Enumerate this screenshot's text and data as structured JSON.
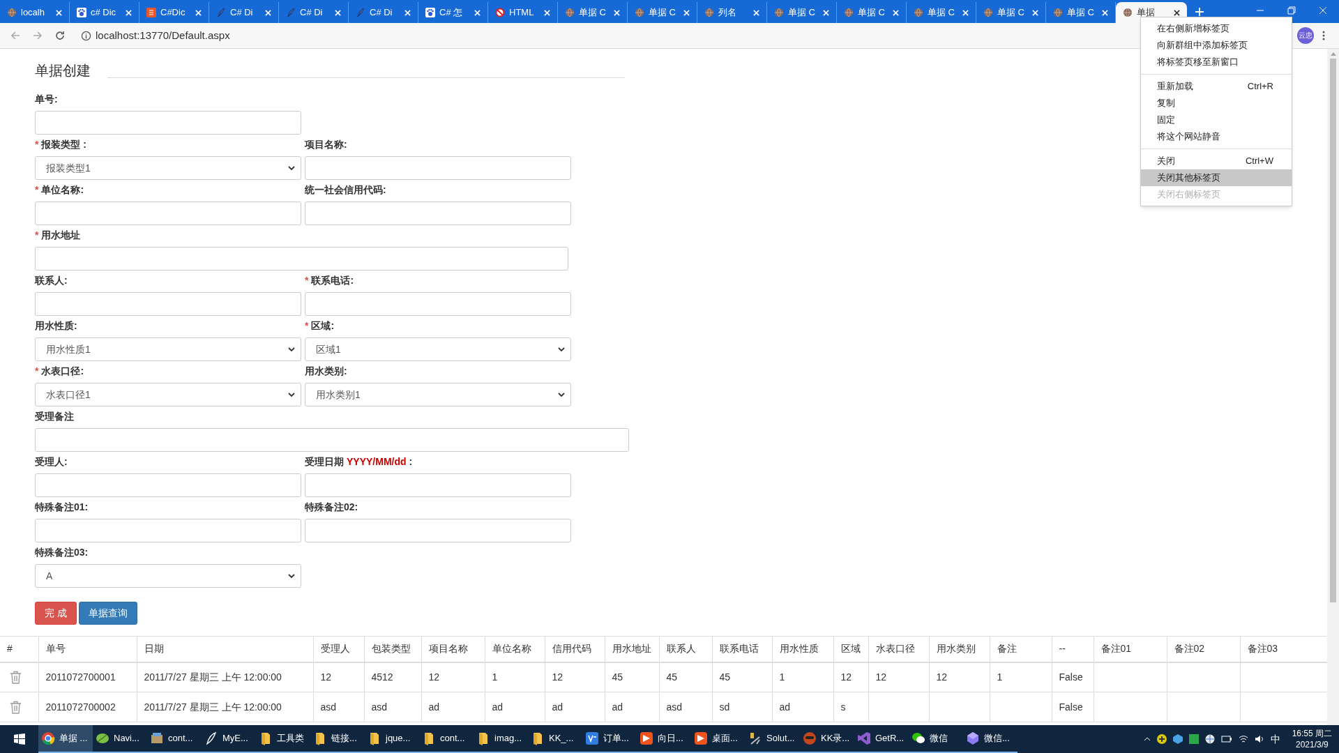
{
  "browser": {
    "tabs": [
      {
        "title": "localh",
        "kind": "globe",
        "selected": false
      },
      {
        "title": "c# Dic",
        "kind": "paw",
        "selected": false
      },
      {
        "title": "C#Dic",
        "kind": "red",
        "selected": false
      },
      {
        "title": "C# Di",
        "kind": "feather",
        "selected": false
      },
      {
        "title": "C# Di",
        "kind": "feather",
        "selected": false
      },
      {
        "title": "C# Di",
        "kind": "feather",
        "selected": false
      },
      {
        "title": "C# 怎",
        "kind": "paw",
        "selected": false
      },
      {
        "title": "HTML",
        "kind": "ban",
        "selected": false
      },
      {
        "title": "单据 C",
        "kind": "globe",
        "selected": false
      },
      {
        "title": "单据 C",
        "kind": "globe",
        "selected": false
      },
      {
        "title": "列名",
        "kind": "globe",
        "selected": false
      },
      {
        "title": "单据 C",
        "kind": "globe",
        "selected": false
      },
      {
        "title": "单据 C",
        "kind": "globe",
        "selected": false
      },
      {
        "title": "单据 C",
        "kind": "globe",
        "selected": false
      },
      {
        "title": "单据 C",
        "kind": "globe",
        "selected": false
      },
      {
        "title": "单据 C",
        "kind": "globe",
        "selected": false
      },
      {
        "title": "单据",
        "kind": "globe",
        "selected": true
      }
    ],
    "address": "localhost:13770/Default.aspx",
    "profile": "云忠"
  },
  "context_menu": {
    "groups": [
      [
        {
          "label": "在右侧新增标签页",
          "selected": false,
          "disabled": false
        },
        {
          "label": "向新群组中添加标签页",
          "selected": false,
          "disabled": false
        },
        {
          "label": "将标签页移至新窗口",
          "selected": false,
          "disabled": false
        }
      ],
      [
        {
          "label": "重新加载",
          "shortcut": "Ctrl+R",
          "selected": false,
          "disabled": false
        },
        {
          "label": "复制",
          "selected": false,
          "disabled": false
        },
        {
          "label": "固定",
          "selected": false,
          "disabled": false
        },
        {
          "label": "将这个网站静音",
          "selected": false,
          "disabled": false
        }
      ],
      [
        {
          "label": "关闭",
          "shortcut": "Ctrl+W",
          "selected": false,
          "disabled": false
        },
        {
          "label": "关闭其他标签页",
          "selected": true,
          "disabled": false
        },
        {
          "label": "关闭右侧标签页",
          "selected": false,
          "disabled": true
        }
      ]
    ]
  },
  "page": {
    "title": "单据创建",
    "rows": [
      [
        {
          "label": "单号:",
          "kind": "input"
        }
      ],
      [
        {
          "mark": "*",
          "label": "报装类型 :",
          "kind": "select",
          "value": "报装类型1"
        },
        {
          "label": "项目名称:",
          "kind": "input"
        }
      ],
      [
        {
          "mark": "*",
          "label": "单位名称:",
          "kind": "input"
        },
        {
          "label": "统一社会信用代码:",
          "kind": "input"
        }
      ],
      [
        {
          "mark": "*",
          "label": "用水地址",
          "kind": "wide"
        }
      ],
      [
        {
          "label": "联系人:",
          "kind": "input"
        },
        {
          "mark": "*",
          "label": "联系电话:",
          "kind": "input"
        }
      ],
      [
        {
          "label": "用水性质:",
          "kind": "select",
          "value": "用水性质1"
        },
        {
          "mark": "*",
          "label": "区域:",
          "kind": "select",
          "value": "区域1"
        }
      ],
      [
        {
          "mark": "*",
          "label": "水表口径:",
          "kind": "select",
          "value": "水表口径1"
        },
        {
          "label": "用水类别:",
          "kind": "select",
          "value": "用水类别1"
        }
      ],
      [
        {
          "label": "受理备注",
          "kind": "full"
        }
      ],
      [
        {
          "label": "受理人:",
          "kind": "input"
        },
        {
          "label": "受理日期",
          "format": "YYYY/MM/dd",
          "label_end": ":",
          "kind": "input"
        }
      ],
      [
        {
          "label": "特殊备注01:",
          "kind": "input"
        },
        {
          "label": "特殊备注02:",
          "kind": "input"
        }
      ],
      [
        {
          "label": "特殊备注03:",
          "kind": "select",
          "value": "A"
        }
      ]
    ],
    "buttons": [
      {
        "label": "完 成",
        "kind": "danger"
      },
      {
        "label": "单据查询",
        "kind": "primary"
      }
    ],
    "table": {
      "columns": [
        "#",
        "单号",
        "日期",
        "受理人",
        "包装类型",
        "项目名称",
        "单位名称",
        "信用代码",
        "用水地址",
        "联系人",
        "联系电话",
        "用水性质",
        "区域",
        "水表口径",
        "用水类别",
        "备注",
        "--",
        "备注01",
        "备注02",
        "备注03"
      ],
      "rows": [
        [
          "",
          "2011072700001",
          "2011/7/27 星期三 上午 12:00:00",
          "12",
          "4512",
          "12",
          "1",
          "12",
          "45",
          "45",
          "45",
          "1",
          "12",
          "12",
          "12",
          "1",
          "False",
          "",
          "",
          ""
        ],
        [
          "",
          "2011072700002",
          "2011/7/27 星期三 上午 12:00:00",
          "asd",
          "asd",
          "ad",
          "ad",
          "ad",
          "ad",
          "asd",
          "sd",
          "ad",
          "s",
          "",
          "",
          "",
          "False",
          "",
          "",
          ""
        ]
      ]
    }
  },
  "taskbar": {
    "items": [
      {
        "label": "单据 ...",
        "kind": "chrome",
        "selected": true
      },
      {
        "label": "Navi...",
        "kind": "leaf",
        "selected": false
      },
      {
        "label": "cont...",
        "kind": "box",
        "selected": false
      },
      {
        "label": "MyE...",
        "kind": "pen",
        "selected": false
      },
      {
        "label": "工具类",
        "kind": "folder",
        "selected": false
      },
      {
        "label": "链接...",
        "kind": "folder",
        "selected": false
      },
      {
        "label": "jque...",
        "kind": "folder",
        "selected": false
      },
      {
        "label": "cont...",
        "kind": "folder",
        "selected": false
      },
      {
        "label": "imag...",
        "kind": "folder",
        "selected": false
      },
      {
        "label": "KK_...",
        "kind": "folder",
        "selected": false
      },
      {
        "label": "订单...",
        "kind": "bluesq",
        "selected": false
      },
      {
        "label": "向日...",
        "kind": "orange",
        "selected": false
      },
      {
        "label": "桌面...",
        "kind": "orange",
        "selected": false
      },
      {
        "label": "Solut...",
        "kind": "tools",
        "selected": false
      },
      {
        "label": "KK录...",
        "kind": "kk",
        "selected": false
      },
      {
        "label": "GetR...",
        "kind": "vs",
        "selected": false
      },
      {
        "label": "微信",
        "kind": "chat",
        "selected": false
      },
      {
        "label": "微信...",
        "kind": "cube",
        "selected": false
      }
    ],
    "ime": "中",
    "time": "16:55 周二",
    "date": "2021/3/9"
  }
}
